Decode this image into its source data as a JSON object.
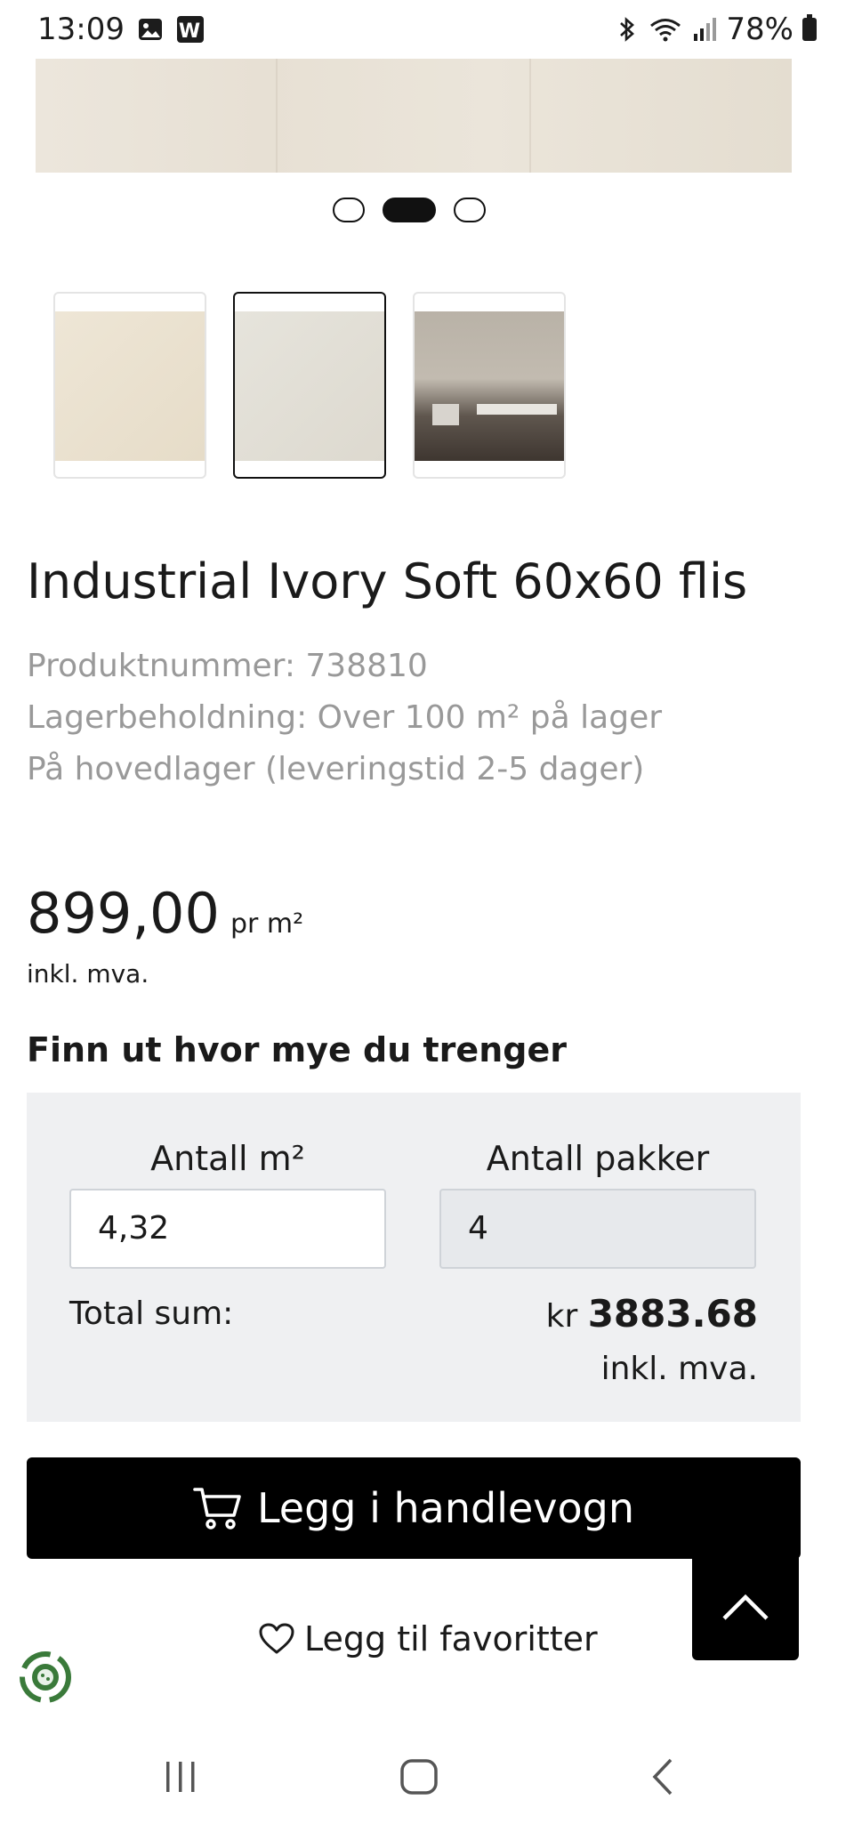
{
  "status_bar": {
    "time": "13:09",
    "battery": "78%",
    "icons": [
      "gallery-icon",
      "w-app-icon",
      "bluetooth-icon",
      "wifi-icon",
      "signal-icon",
      "battery-icon"
    ]
  },
  "carousel": {
    "dot_count": 3,
    "active_index": 1
  },
  "thumbnails": [
    {
      "name": "ivory-tile-closeup",
      "selected": false
    },
    {
      "name": "ivory-tile-texture",
      "selected": true
    },
    {
      "name": "room-scene",
      "selected": false
    }
  ],
  "product": {
    "title": "Industrial Ivory Soft 60x60 flis",
    "product_number": "Produktnummer: 738810",
    "stock": "Lagerbeholdning: Over 100 m² på lager",
    "warehouse": "På hovedlager (leveringstid 2-5 dager)",
    "price": "899,00",
    "price_unit": "pr m²",
    "vat_note": "inkl. mva."
  },
  "calculator": {
    "heading": "Finn ut hvor mye du trenger",
    "m2_label": "Antall m²",
    "m2_value": "4,32",
    "packages_label": "Antall pakker",
    "packages_value": "4",
    "total_label": "Total sum:",
    "currency": "kr",
    "total_amount": "3883.68",
    "total_vat": "inkl. mva."
  },
  "actions": {
    "add_to_cart": "Legg i handlevogn",
    "add_to_favorites": "Legg til favoritter"
  },
  "colors": {
    "accent": "#000000",
    "muted_text": "#999999",
    "calc_bg": "#eff0f2",
    "eco_green": "#3a7a3a"
  }
}
